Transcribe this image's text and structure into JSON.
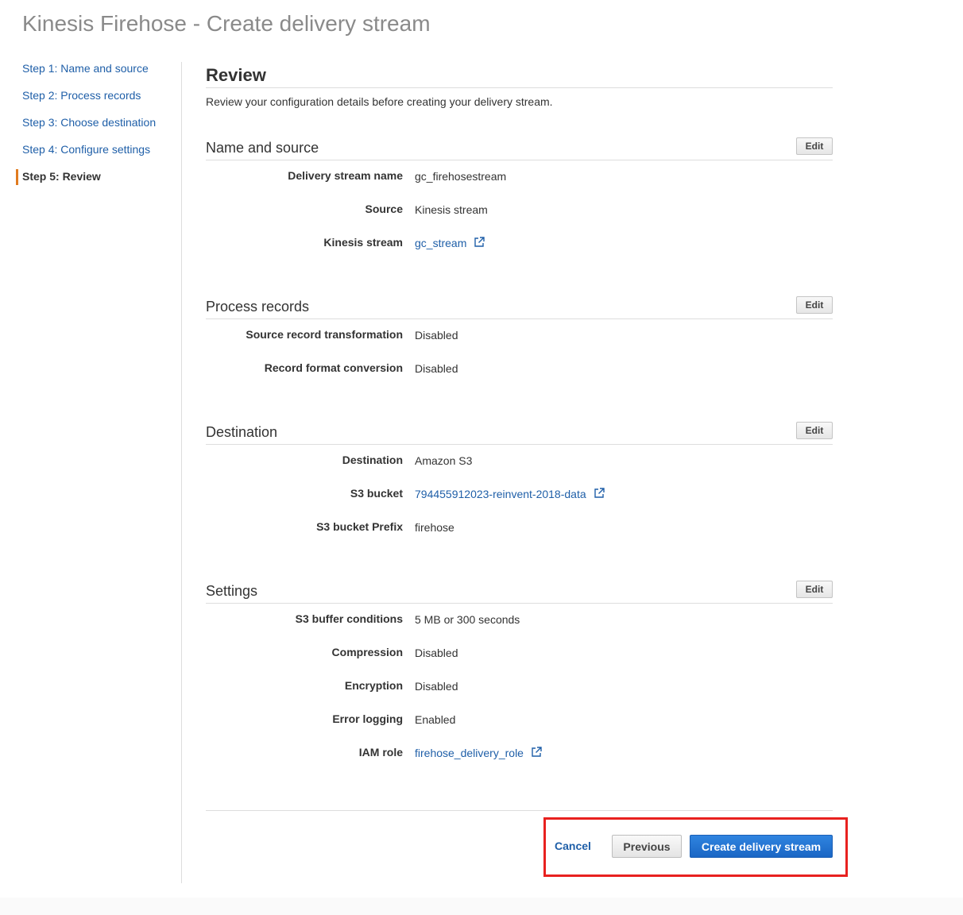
{
  "page_title": "Kinesis Firehose - Create delivery stream",
  "steps": [
    {
      "label": "Step 1: Name and source",
      "active": false
    },
    {
      "label": "Step 2: Process records",
      "active": false
    },
    {
      "label": "Step 3: Choose destination",
      "active": false
    },
    {
      "label": "Step 4: Configure settings",
      "active": false
    },
    {
      "label": "Step 5: Review",
      "active": true
    }
  ],
  "review": {
    "title": "Review",
    "description": "Review your configuration details before creating your delivery stream."
  },
  "edit_label": "Edit",
  "sections": {
    "name_source": {
      "title": "Name and source",
      "rows": [
        {
          "label": "Delivery stream name",
          "value": "gc_firehosestream"
        },
        {
          "label": "Source",
          "value": "Kinesis stream"
        },
        {
          "label": "Kinesis stream",
          "value": "gc_stream"
        }
      ]
    },
    "process_records": {
      "title": "Process records",
      "rows": [
        {
          "label": "Source record transformation",
          "value": "Disabled"
        },
        {
          "label": "Record format conversion",
          "value": "Disabled"
        }
      ]
    },
    "destination": {
      "title": "Destination",
      "rows": [
        {
          "label": "Destination",
          "value": "Amazon S3"
        },
        {
          "label": "S3 bucket",
          "value": "794455912023-reinvent-2018-data"
        },
        {
          "label": "S3 bucket Prefix",
          "value": "firehose"
        }
      ]
    },
    "settings": {
      "title": "Settings",
      "rows": [
        {
          "label": "S3 buffer conditions",
          "value": "5 MB or 300 seconds"
        },
        {
          "label": "Compression",
          "value": "Disabled"
        },
        {
          "label": "Encryption",
          "value": "Disabled"
        },
        {
          "label": "Error logging",
          "value": "Enabled"
        },
        {
          "label": "IAM role",
          "value": "firehose_delivery_role"
        }
      ]
    }
  },
  "actions": {
    "cancel": "Cancel",
    "previous": "Previous",
    "create": "Create delivery stream"
  },
  "colors": {
    "link": "#1f5fa8",
    "primary_button": "#1a66c5",
    "active_step_marker": "#e07b1f",
    "highlight_box": "#e8211f"
  },
  "icons": {
    "external_link": "external-link-icon"
  }
}
